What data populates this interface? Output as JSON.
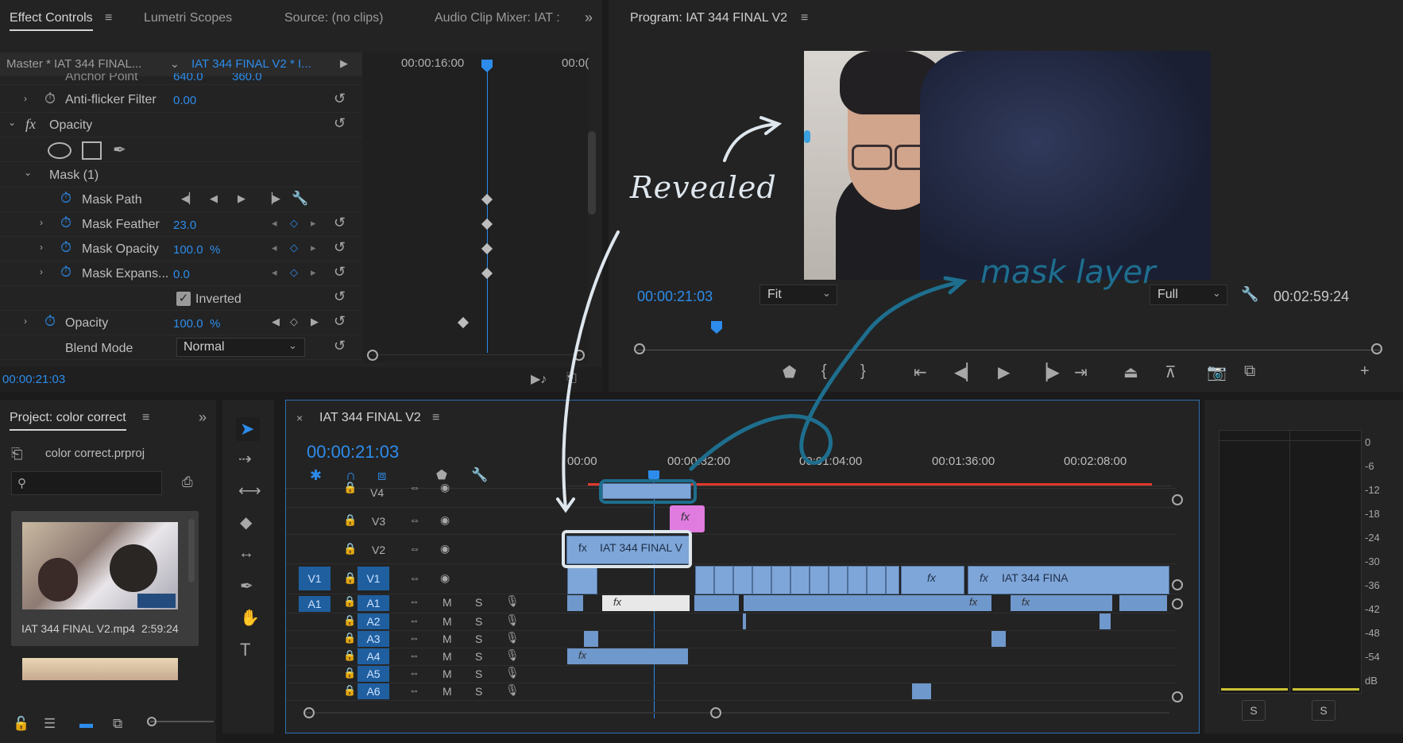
{
  "effect_controls": {
    "tabs": [
      "Effect Controls",
      "Lumetri Scopes",
      "Source: (no clips)",
      "Audio Clip Mixer: IAT :"
    ],
    "master_label": "Master * IAT 344 FINAL...",
    "sequence_label": "IAT 344 FINAL V2 * I...",
    "ruler_time": "00:00:16:00",
    "ruler_time2": "00:0(",
    "rows": {
      "anchor": {
        "label": "Anchor Point",
        "v1": "640.0",
        "v2": "360.0"
      },
      "antiflicker": {
        "label": "Anti-flicker Filter",
        "value": "0.00"
      },
      "opacity_header": {
        "label": "Opacity",
        "fx": "fx"
      },
      "mask": {
        "label": "Mask (1)"
      },
      "mask_path": {
        "label": "Mask Path"
      },
      "mask_feather": {
        "label": "Mask Feather",
        "value": "23.0"
      },
      "mask_opacity": {
        "label": "Mask Opacity",
        "value": "100.0",
        "unit": "%"
      },
      "mask_expansion": {
        "label": "Mask Expans...",
        "value": "0.0"
      },
      "inverted": {
        "label": "Inverted",
        "checked": true
      },
      "opacity": {
        "label": "Opacity",
        "value": "100.0",
        "unit": "%"
      },
      "blend": {
        "label": "Blend Mode",
        "value": "Normal"
      }
    },
    "timecode": "00:00:21:03"
  },
  "program": {
    "title": "Program: IAT 344 FINAL V2",
    "timecode": "00:00:21:03",
    "fit": "Fit",
    "quality": "Full",
    "duration": "00:02:59:24",
    "annotations": {
      "revealed": "Revealed",
      "mask_layer": "mask layer"
    }
  },
  "project": {
    "title": "Project: color correct",
    "file": "color correct.prproj",
    "search_placeholder": "",
    "item_label": "IAT 344 FINAL V2.mp4",
    "item_duration": "2:59:24"
  },
  "timeline": {
    "title": "IAT 344 FINAL V2",
    "timecode": "00:00:21:03",
    "ruler": [
      "00:00",
      "00:00:32:00",
      "00:01:04:00",
      "00:01:36:00",
      "00:02:08:00"
    ],
    "video_tracks": [
      "V4",
      "V3",
      "V2",
      "V1"
    ],
    "audio_tracks": [
      "A1",
      "A2",
      "A3",
      "A4",
      "A5",
      "A6"
    ],
    "source_v": "V1",
    "source_a": "A1",
    "m": "M",
    "s": "S",
    "clip_v2": "IAT 344 FINAL V",
    "clip_v1": "IAT 344 FINA",
    "fx": "fx"
  },
  "meter": {
    "scale": [
      "0",
      "-6",
      "-12",
      "-18",
      "-24",
      "-30",
      "-36",
      "-42",
      "-48",
      "-54",
      "dB"
    ],
    "s_left": "S",
    "s_right": "S"
  },
  "colors": {
    "accent": "#2d8ceb",
    "clip_video": "#7fa6d8",
    "clip_pink": "#e07be0",
    "annotation_teal": "#1e6e8e",
    "annotation_white": "#dfe7ee"
  }
}
